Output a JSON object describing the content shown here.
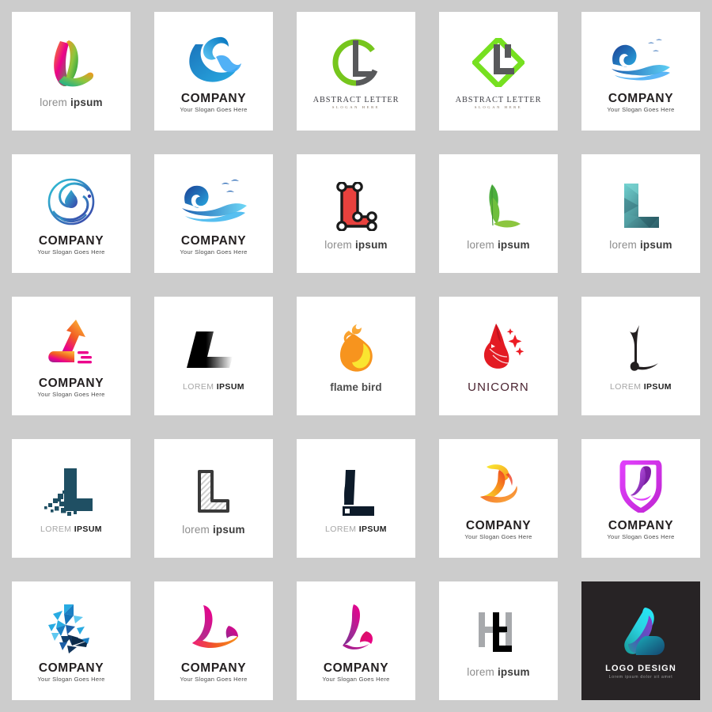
{
  "page": {
    "background_color": "#cccccc",
    "tile_background": "#ffffff",
    "columns": 5,
    "rows": 5,
    "total_tiles": 25
  },
  "captions": {
    "lorem_ipsum_lower": "lorem ipsum",
    "lorem_lower_light": "lorem ",
    "ipsum_lower_bold": "ipsum",
    "lorem_upper_light": "LOREM ",
    "ipsum_upper_bold": "IPSUM",
    "company": "COMPANY",
    "slogan": "Your Slogan Goes Here",
    "abstract_letter": "ABSTRACT LETTER",
    "slogan_here": "SLOGAN HERE",
    "flame_bird": "flame bird",
    "unicorn": "UNICORN",
    "logo_design": "LOGO DESIGN",
    "logo_design_sub": "Lorem ipsum dolor sit amet"
  },
  "tiles": [
    {
      "id": 1,
      "row": 1,
      "col": 1,
      "icon": "rainbow-swoosh-l-icon",
      "caption_style": "lorem-lower",
      "colors": [
        "#f7941e",
        "#e6007e",
        "#8cc63f",
        "#39b54a",
        "#f15a29"
      ]
    },
    {
      "id": 2,
      "row": 1,
      "col": 2,
      "icon": "blue-wave-crescent-icon",
      "caption_style": "company",
      "colors": [
        "#1b75bc",
        "#29abe2",
        "#0071bc"
      ]
    },
    {
      "id": 3,
      "row": 1,
      "col": 3,
      "icon": "circle-green-gray-letter-icon",
      "caption_style": "abstract",
      "colors": [
        "#76c61d",
        "#58595b"
      ]
    },
    {
      "id": 4,
      "row": 1,
      "col": 4,
      "icon": "diamond-green-gray-letter-icon",
      "caption_style": "abstract",
      "colors": [
        "#76e020",
        "#58595b"
      ]
    },
    {
      "id": 5,
      "row": 1,
      "col": 5,
      "icon": "blue-wave-birds-icon",
      "caption_style": "company",
      "colors": [
        "#1b3f94",
        "#29abe2",
        "#3fa9f5"
      ]
    },
    {
      "id": 6,
      "row": 2,
      "col": 1,
      "icon": "swirl-waterdrop-circle-icon",
      "caption_style": "company",
      "colors": [
        "#2ec4d6",
        "#3b3fa8"
      ]
    },
    {
      "id": 7,
      "row": 2,
      "col": 2,
      "icon": "blue-wave-birds-wide-icon",
      "caption_style": "company",
      "colors": [
        "#1b3f94",
        "#29abe2",
        "#3fa9f5"
      ]
    },
    {
      "id": 8,
      "row": 2,
      "col": 3,
      "icon": "red-node-bracket-l-icon",
      "caption_style": "lorem-lower",
      "colors": [
        "#e8413d",
        "#1a1a1a"
      ]
    },
    {
      "id": 9,
      "row": 2,
      "col": 4,
      "icon": "green-leaf-sprout-l-icon",
      "caption_style": "lorem-lower",
      "colors": [
        "#4caf3e",
        "#8cc63f"
      ]
    },
    {
      "id": 10,
      "row": 2,
      "col": 5,
      "icon": "teal-faceted-l-icon",
      "caption_style": "lorem-lower",
      "colors": [
        "#5fc6c6",
        "#2c5c66"
      ]
    },
    {
      "id": 11,
      "row": 3,
      "col": 1,
      "icon": "arrow-up-gradient-l-icon",
      "caption_style": "company",
      "colors": [
        "#fbb034",
        "#f15a24",
        "#ec008c",
        "#92278f"
      ]
    },
    {
      "id": 12,
      "row": 3,
      "col": 2,
      "icon": "black-fade-speed-l-icon",
      "caption_style": "lorem-upper",
      "colors": [
        "#000000",
        "#ffffff"
      ]
    },
    {
      "id": 13,
      "row": 3,
      "col": 3,
      "icon": "flame-bird-icon",
      "caption_style": "flame",
      "colors": [
        "#f7941e",
        "#fbb040",
        "#f9ed32"
      ]
    },
    {
      "id": 14,
      "row": 3,
      "col": 4,
      "icon": "unicorn-head-icon",
      "caption_style": "unicorn",
      "colors": [
        "#e31b23",
        "#ed1c24"
      ]
    },
    {
      "id": 15,
      "row": 3,
      "col": 5,
      "icon": "calligraphy-brush-l-icon",
      "caption_style": "lorem-upper",
      "colors": [
        "#231f20"
      ]
    },
    {
      "id": 16,
      "row": 4,
      "col": 1,
      "icon": "pixel-dissolve-l-icon",
      "caption_style": "lorem-upper",
      "colors": [
        "#1f4f63"
      ]
    },
    {
      "id": 17,
      "row": 4,
      "col": 2,
      "icon": "hatched-outline-l-icon",
      "caption_style": "lorem-lower",
      "colors": [
        "#3a3a3a",
        "#c9c9c9"
      ]
    },
    {
      "id": 18,
      "row": 4,
      "col": 3,
      "icon": "sharp-serif-l-icon",
      "caption_style": "lorem-upper",
      "colors": [
        "#0d1b2a"
      ]
    },
    {
      "id": 19,
      "row": 4,
      "col": 4,
      "icon": "orange-ribbon-swan-l-icon",
      "caption_style": "company",
      "colors": [
        "#f9ed32",
        "#f7941e",
        "#ef4023"
      ]
    },
    {
      "id": 20,
      "row": 4,
      "col": 5,
      "icon": "purple-shield-l-icon",
      "caption_style": "company",
      "colors": [
        "#e040fb",
        "#7b1fa2",
        "#c026d3"
      ]
    },
    {
      "id": 21,
      "row": 5,
      "col": 1,
      "icon": "polygon-mosaic-l-icon",
      "caption_style": "company",
      "colors": [
        "#29abe2",
        "#1b3f94",
        "#0d2b4a"
      ]
    },
    {
      "id": 22,
      "row": 5,
      "col": 2,
      "icon": "magenta-orange-swoosh-l-icon",
      "caption_style": "company",
      "colors": [
        "#ec008c",
        "#92278f",
        "#f7941e"
      ]
    },
    {
      "id": 23,
      "row": 5,
      "col": 3,
      "icon": "pink-ribbon-l-icon",
      "caption_style": "company",
      "colors": [
        "#ec008c",
        "#92278f",
        "#d4145a"
      ]
    },
    {
      "id": 24,
      "row": 5,
      "col": 4,
      "icon": "gray-black-monogram-hl-icon",
      "caption_style": "lorem-lower",
      "colors": [
        "#a7a9ac",
        "#000000"
      ]
    },
    {
      "id": 25,
      "row": 5,
      "col": 5,
      "icon": "teal-purple-gradient-l-icon",
      "caption_style": "logo-design",
      "colors": [
        "#27e5f5",
        "#6b3fa0",
        "#1f7a8c"
      ],
      "dark": true
    }
  ]
}
